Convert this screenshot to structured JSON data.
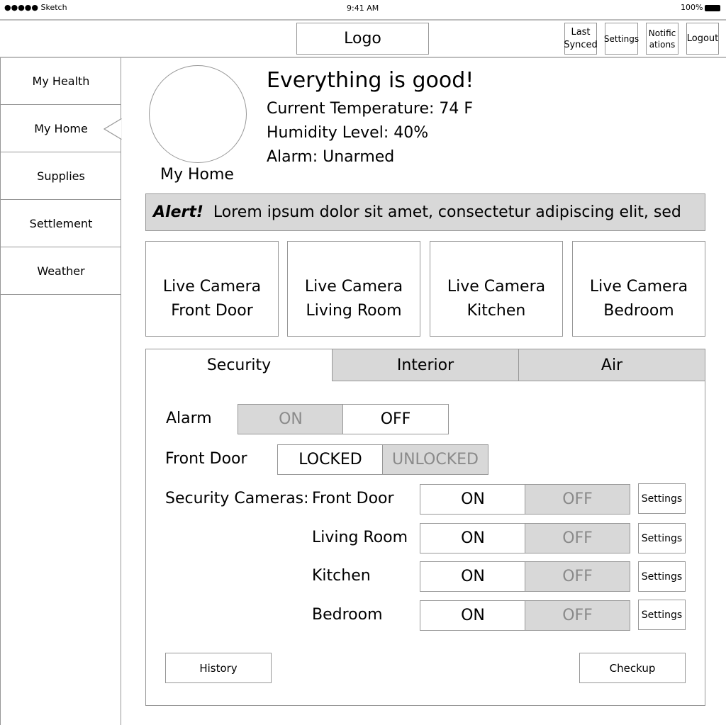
{
  "status_bar": {
    "carrier": "●●●●● Sketch",
    "time": "9:41 AM",
    "battery": "100%"
  },
  "header": {
    "logo": "Logo",
    "buttons": [
      "Last Synced",
      "Settings",
      "Notifications",
      "Logout"
    ]
  },
  "sidebar": {
    "items": [
      {
        "label": "My Health"
      },
      {
        "label": "My Home",
        "selected": true
      },
      {
        "label": "Supplies"
      },
      {
        "label": "Settlement"
      },
      {
        "label": "Weather"
      }
    ]
  },
  "home": {
    "name": "My Home",
    "headline": "Everything is good!",
    "temperature": "Current Temperature: 74 F",
    "humidity": "Humidity Level: 40%",
    "alarm": "Alarm: Unarmed"
  },
  "alert": {
    "label": "Alert!",
    "text": "Lorem ipsum dolor sit amet, consectetur adipiscing elit, sed"
  },
  "cameras": [
    {
      "line1": "Live Camera",
      "line2": "Front Door"
    },
    {
      "line1": "Live Camera",
      "line2": "Living Room"
    },
    {
      "line1": "Live Camera",
      "line2": "Kitchen"
    },
    {
      "line1": "Live Camera",
      "line2": "Bedroom"
    }
  ],
  "tabs": [
    {
      "label": "Security",
      "active": true
    },
    {
      "label": "Interior"
    },
    {
      "label": "Air"
    }
  ],
  "security": {
    "alarm": {
      "label": "Alarm",
      "on": "ON",
      "off": "OFF",
      "state": "OFF"
    },
    "front_door": {
      "label": "Front Door",
      "locked": "LOCKED",
      "unlocked": "UNLOCKED",
      "state": "LOCKED"
    },
    "cameras_label": "Security Cameras:",
    "cameras": [
      {
        "room": "Front Door",
        "on": "ON",
        "off": "OFF",
        "state": "ON",
        "settings": "Settings"
      },
      {
        "room": "Living Room",
        "on": "ON",
        "off": "OFF",
        "state": "ON",
        "settings": "Settings"
      },
      {
        "room": "Kitchen",
        "on": "ON",
        "off": "OFF",
        "state": "ON",
        "settings": "Settings"
      },
      {
        "room": "Bedroom",
        "on": "ON",
        "off": "OFF",
        "state": "ON",
        "settings": "Settings"
      }
    ],
    "history": "History",
    "checkup": "Checkup"
  }
}
